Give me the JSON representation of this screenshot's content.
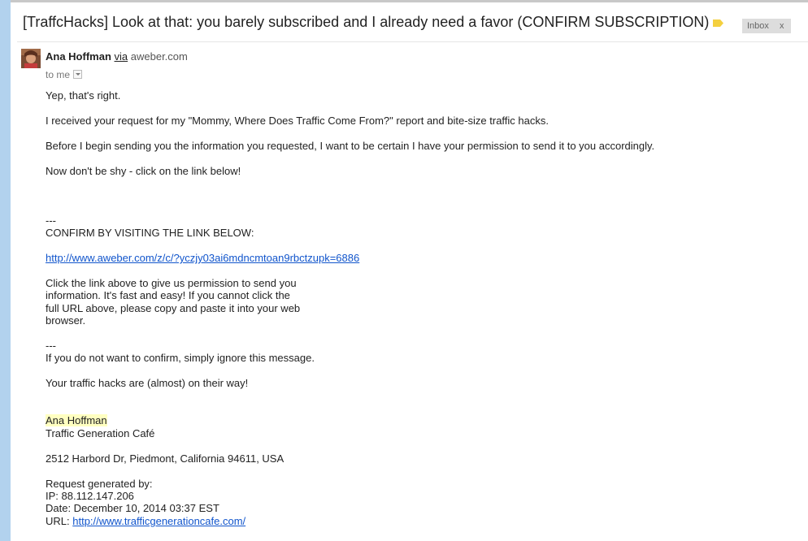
{
  "email": {
    "subject": "[TraffcHacks] Look at that: you barely subscribed and I already need a favor (CONFIRM SUBSCRIPTION)",
    "labels": {
      "inbox": "Inbox",
      "remove": "x"
    },
    "sender": {
      "name": "Ana Hoffman",
      "via": "via",
      "domain": "aweber.com"
    },
    "recipient": "to me",
    "body": {
      "p1": "Yep, that's right.",
      "p2": "I received your request for my \"Mommy, Where Does Traffic Come From?\" report and bite-size traffic hacks.",
      "p3": "Before I begin sending you the information you requested, I want to be certain I have your permission to send it to you accordingly.",
      "p4": "Now don't be shy - click on the link below!",
      "sep1": "---",
      "confirm_heading": "CONFIRM BY VISITING THE LINK BELOW:",
      "confirm_link": "http://www.aweber.com/z/c/?yczjy03ai6mdncmtoan9rbctzupk=6886",
      "click_l1": "Click the link above to give us permission to send you",
      "click_l2": "information.  It's fast and easy!  If you cannot click the",
      "click_l3": "full URL above, please copy and paste it into your web",
      "click_l4": "browser.",
      "sep2": "---",
      "ignore": "If you do not want to confirm, simply ignore this message.",
      "on_way": "Your traffic hacks are (almost) on their way!",
      "sig_name": "Ana Hoffman",
      "sig_company": "Traffic Generation Café",
      "address": "2512 Harbord Dr, Piedmont, California 94611, USA",
      "req_title": "Request generated by:",
      "req_ip": "IP: 88.112.147.206",
      "req_date": "Date: December 10, 2014 03:37 EST",
      "req_url_label": "URL: ",
      "req_url": "http://www.trafficgenerationcafe.com/"
    }
  },
  "colors": {
    "link": "#1155cc",
    "highlight": "#ffffc0",
    "label_tag": "#f4d03f",
    "side_strip": "#b2d2ee"
  }
}
